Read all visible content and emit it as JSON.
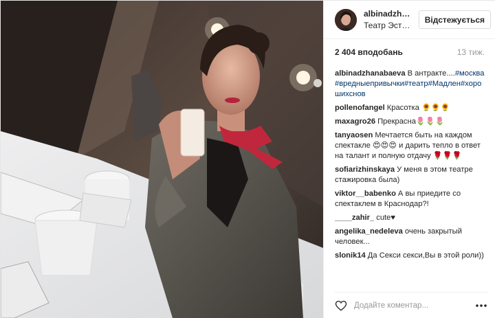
{
  "post": {
    "image_alt": "Фото публікації",
    "username": "albinadzhanabaeva",
    "username_short": "albinadzhan...",
    "location": "Театр Эстра...",
    "follow_label": "Відстежується",
    "likes": "2 404 вподобань",
    "age": "13 тиж."
  },
  "comments": [
    {
      "user": "albinadzhanabaeva",
      "parts": [
        {
          "t": "text",
          "v": "В антракте...."
        },
        {
          "t": "tag",
          "v": "#москва"
        },
        {
          "t": "text",
          "v": " "
        },
        {
          "t": "tag",
          "v": "#вредныепривычки"
        },
        {
          "t": "tag",
          "v": "#театр"
        },
        {
          "t": "tag",
          "v": "#Мадлен"
        },
        {
          "t": "tag",
          "v": "#хорошихснов"
        }
      ]
    },
    {
      "user": "pollenofangel",
      "parts": [
        {
          "t": "text",
          "v": "Красотка 🌻🌻🌻"
        }
      ]
    },
    {
      "user": "maxagro26",
      "parts": [
        {
          "t": "text",
          "v": "Прекрасна🌷🌷🌷"
        }
      ]
    },
    {
      "user": "tanyaosen",
      "parts": [
        {
          "t": "text",
          "v": "Мечтается быть на каждом спектакле 😍😍😍 и дарить тепло в ответ на талант и полную отдачу 🌹🌹🌹"
        }
      ]
    },
    {
      "user": "sofiarizhinskaya",
      "parts": [
        {
          "t": "text",
          "v": "У меня в этом театре стажировка была)"
        }
      ]
    },
    {
      "user": "viktor__babenko",
      "parts": [
        {
          "t": "text",
          "v": "А вы приедите со спектаклем в Краснодар?!"
        }
      ]
    },
    {
      "user": "____zahir_",
      "parts": [
        {
          "t": "text",
          "v": "cute♥"
        }
      ]
    },
    {
      "user": "angelika_nedeleva",
      "parts": [
        {
          "t": "text",
          "v": "очень закрытый человек..."
        }
      ]
    },
    {
      "user": "slonik14",
      "parts": [
        {
          "t": "text",
          "v": "Да Секси секси,Вы в этой роли))"
        }
      ]
    }
  ],
  "comment_box": {
    "placeholder": "Додайте коментар...",
    "heart_icon": "heart-icon",
    "more_icon": "more-options-icon"
  },
  "colors": {
    "link": "#003569",
    "text": "#262626",
    "muted": "#999999",
    "border": "#efefef"
  }
}
